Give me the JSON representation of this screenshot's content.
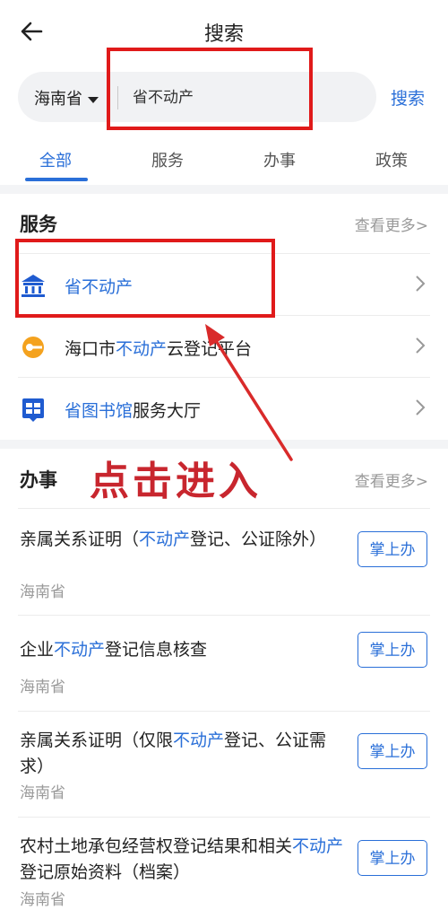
{
  "header": {
    "title": "搜索"
  },
  "search": {
    "region": "海南省",
    "query": "省不动产",
    "button": "搜索"
  },
  "tabs": [
    {
      "label": "全部",
      "active": true
    },
    {
      "label": "服务",
      "active": false
    },
    {
      "label": "办事",
      "active": false
    },
    {
      "label": "政策",
      "active": false
    }
  ],
  "services": {
    "title": "服务",
    "more": "查看更多>",
    "items": [
      {
        "parts": [
          {
            "text": "省不动产",
            "hl": true
          }
        ],
        "icon": "government-building-icon"
      },
      {
        "parts": [
          {
            "text": "海口市",
            "hl": false
          },
          {
            "text": "不动产",
            "hl": true
          },
          {
            "text": "云登记平台",
            "hl": false
          }
        ],
        "icon": "key-icon"
      },
      {
        "parts": [
          {
            "text": "省图书馆",
            "hl": true
          },
          {
            "text": "服务大厅",
            "hl": false
          }
        ],
        "icon": "library-icon"
      }
    ]
  },
  "annotation": {
    "text": "点击进入"
  },
  "affairs": {
    "title": "办事",
    "more": "查看更多>",
    "action_label": "掌上办",
    "items": [
      {
        "parts": [
          {
            "text": "亲属关系证明（",
            "hl": false
          },
          {
            "text": "不动产",
            "hl": true
          },
          {
            "text": "登记、公证除外）",
            "hl": false
          }
        ],
        "province": "海南省"
      },
      {
        "parts": [
          {
            "text": "企业",
            "hl": false
          },
          {
            "text": "不动产",
            "hl": true
          },
          {
            "text": "登记信息核查",
            "hl": false
          }
        ],
        "province": "海南省"
      },
      {
        "parts": [
          {
            "text": "亲属关系证明（仅限",
            "hl": false
          },
          {
            "text": "不动产",
            "hl": true
          },
          {
            "text": "登记、公证需求）",
            "hl": false
          }
        ],
        "province": "海南省"
      },
      {
        "parts": [
          {
            "text": "农村土地承包经营权登记结果和相关",
            "hl": false
          },
          {
            "text": "不动产",
            "hl": true
          },
          {
            "text": "登记原始资料（档案）",
            "hl": false
          }
        ],
        "province": "海南省"
      }
    ]
  },
  "colors": {
    "accent": "#2a6fd8",
    "annotation_red": "#e01a1a",
    "icon_blue": "#1f5bd0",
    "icon_orange": "#f4a21e"
  }
}
